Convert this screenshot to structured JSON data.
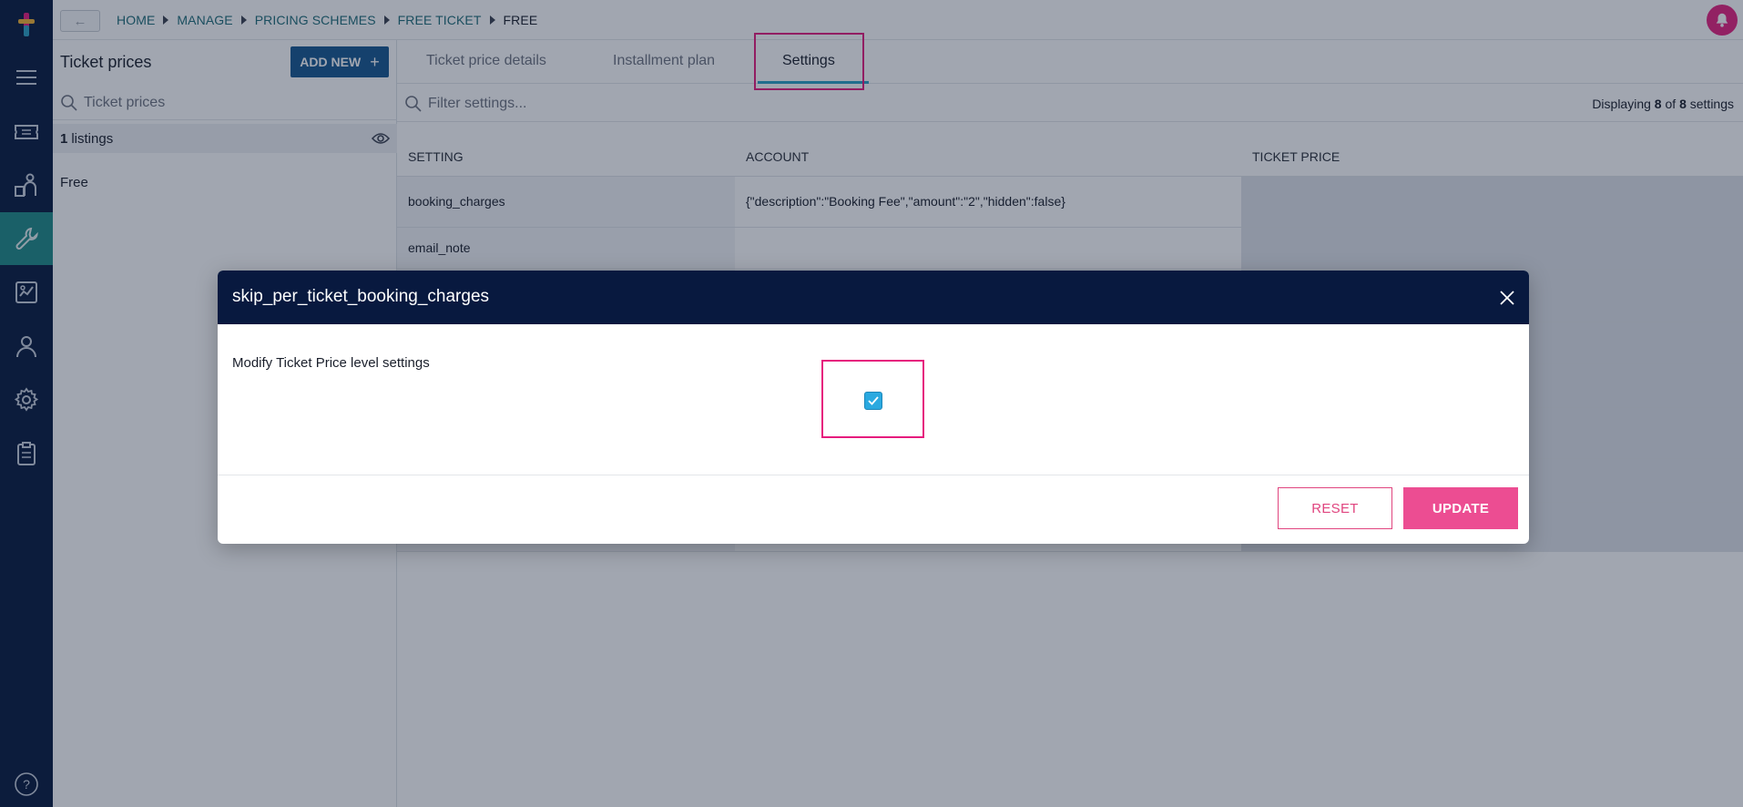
{
  "topbar": {
    "back_label": "←",
    "breadcrumb": [
      "HOME",
      "MANAGE",
      "PRICING SCHEMES",
      "FREE TICKET",
      "FREE"
    ]
  },
  "nav": {
    "items": [
      "menu-icon",
      "ticket-icon",
      "people-icon",
      "wrench-icon",
      "report-icon",
      "user-icon",
      "gear-icon",
      "clipboard-icon"
    ],
    "active": "wrench-icon",
    "help_label": "?"
  },
  "panel": {
    "title": "Ticket prices",
    "add_new_label": "ADD NEW",
    "add_new_icon": "+",
    "search_placeholder": "Ticket prices",
    "listings_count": "1",
    "listings_label": "listings",
    "items": [
      "Free"
    ]
  },
  "main": {
    "tabs": [
      "Ticket price details",
      "Installment plan",
      "Settings"
    ],
    "active_tab": "Settings",
    "filter_placeholder": "Filter settings...",
    "displaying": {
      "prefix": "Displaying",
      "shown": "8",
      "of": "of",
      "total": "8",
      "suffix": "settings"
    },
    "table": {
      "headers": [
        "SETTING",
        "ACCOUNT",
        "TICKET PRICE"
      ],
      "rows": [
        {
          "setting": "booking_charges",
          "account": "{\"description\":\"Booking Fee\",\"amount\":\"2\",\"hidden\":false}",
          "ticket_price": ""
        },
        {
          "setting": "email_note",
          "account": "",
          "ticket_price": ""
        }
      ]
    }
  },
  "modal": {
    "title": "skip_per_ticket_booking_charges",
    "field_label": "Modify Ticket Price level settings",
    "checkbox_checked": true,
    "reset_label": "RESET",
    "update_label": "UPDATE"
  },
  "colors": {
    "nav_bg": "#08193f",
    "nav_active": "#1f8a87",
    "accent_pink": "#e61c7d",
    "add_new_bg": "#17588f",
    "checkbox": "#2aa9e0"
  }
}
